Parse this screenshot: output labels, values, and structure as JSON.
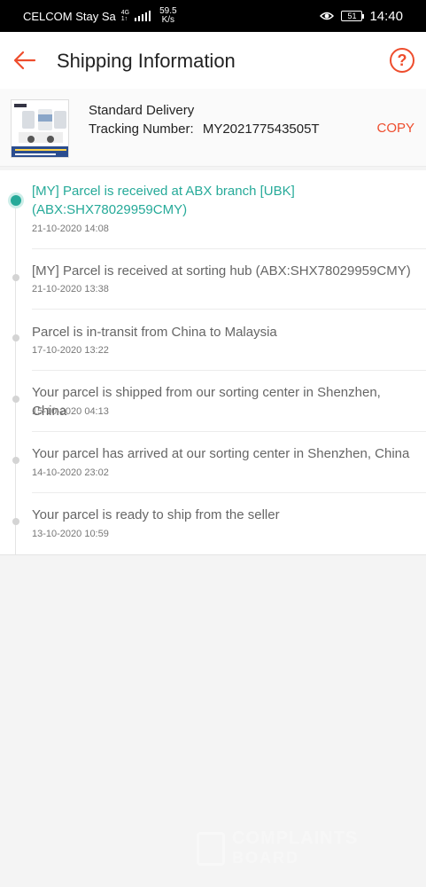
{
  "status_bar": {
    "carrier": "CELCOM Stay Sa",
    "network_top": "4G",
    "network_bottom": "1↑",
    "speed_value": "59.5",
    "speed_unit": "K/s",
    "battery_level": "51",
    "time": "14:40"
  },
  "header": {
    "title": "Shipping Information",
    "help_symbol": "?"
  },
  "summary": {
    "delivery_method": "Standard Delivery",
    "tracking_label": "Tracking Number:",
    "tracking_number": "MY202177543505T",
    "copy_label": "COPY"
  },
  "events": [
    {
      "description": "[MY] Parcel is received at ABX branch [UBK] (ABX:SHX78029959CMY)",
      "time": "21-10-2020 14:08",
      "active": true
    },
    {
      "description": "[MY] Parcel is received at sorting hub (ABX:SHX78029959CMY)",
      "time": "21-10-2020 13:38",
      "active": false
    },
    {
      "description": "Parcel is in-transit from China to Malaysia",
      "time": "17-10-2020 13:22",
      "active": false
    },
    {
      "description": "Your parcel is shipped from our sorting center in Shenzhen, China",
      "time": "15-10-2020 04:13",
      "active": false
    },
    {
      "description": "Your parcel has arrived at our sorting center in Shenzhen, China",
      "time": "14-10-2020 23:02",
      "active": false
    },
    {
      "description": "Your parcel is ready to ship from the seller",
      "time": "13-10-2020 10:59",
      "active": false
    }
  ],
  "colors": {
    "accent": "#ee4d2d",
    "active_status": "#26aa99"
  },
  "watermark": {
    "line1": "COMPLAINTS",
    "line2": "BOARD"
  }
}
